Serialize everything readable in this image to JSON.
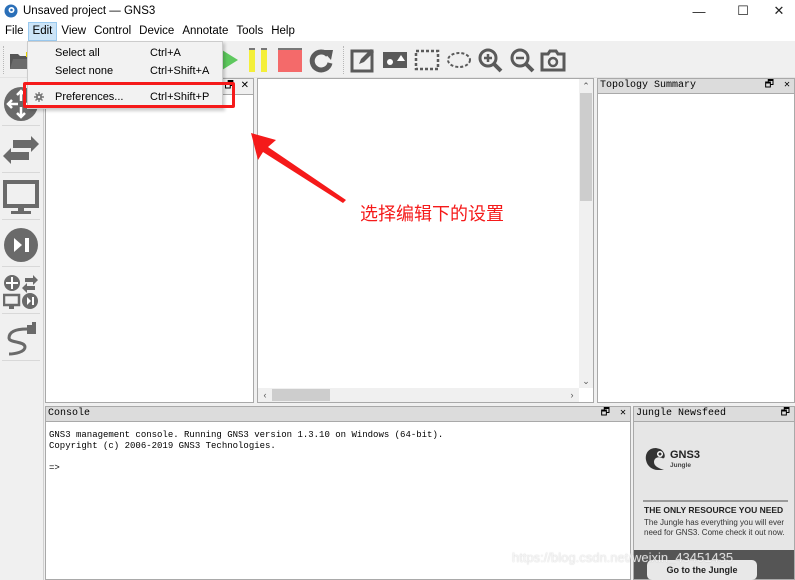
{
  "window": {
    "title": "Unsaved project — GNS3",
    "controls": {
      "minimize": "—",
      "maximize": "☐",
      "close": "✕"
    }
  },
  "menubar": {
    "items": [
      {
        "label": "File"
      },
      {
        "label": "Edit",
        "active": true
      },
      {
        "label": "View"
      },
      {
        "label": "Control"
      },
      {
        "label": "Device"
      },
      {
        "label": "Annotate"
      },
      {
        "label": "Tools"
      },
      {
        "label": "Help"
      }
    ]
  },
  "edit_menu": {
    "items": [
      {
        "label": "Select all",
        "shortcut": "Ctrl+A",
        "icon": ""
      },
      {
        "label": "Select none",
        "shortcut": "Ctrl+Shift+A",
        "icon": ""
      },
      {
        "label": "Preferences...",
        "shortcut": "Ctrl+Shift+P",
        "icon": "gear-icon",
        "highlighted": true
      }
    ]
  },
  "toolbar": {
    "icons": [
      "folder-open-icon",
      "start-icon",
      "suspend-icon",
      "stop-icon",
      "reload-icon",
      "add-note-icon",
      "insert-picture-icon",
      "draw-rectangle-icon",
      "draw-ellipse-icon",
      "zoom-in-icon",
      "zoom-out-icon",
      "screenshot-icon"
    ]
  },
  "devicebar": {
    "items": [
      "routers",
      "switches",
      "end-devices",
      "security-devices",
      "all-devices",
      "add-link"
    ]
  },
  "panels": {
    "nodes": {
      "controls": "🗗 ✕"
    },
    "topology_summary": {
      "title": "Topology Summary",
      "controls": "🗗 ✕"
    },
    "console": {
      "title": "Console",
      "controls": "🗗 ✕",
      "lines": [
        "GNS3 management console. Running GNS3 version 1.3.10 on Windows (64-bit).",
        "Copyright (c) 2006-2019 GNS3 Technologies.",
        "",
        "=>"
      ]
    },
    "newsfeed": {
      "title": "Jungle Newsfeed",
      "controls": "🗗",
      "logo_title": "GNS3",
      "logo_subtitle": "Jungle",
      "headline": "THE ONLY RESOURCE YOU NEED",
      "description": "The Jungle has everything you will ever need for GNS3. Come check it out now.",
      "button": "Go to the Jungle"
    }
  },
  "annotation": {
    "text": "选择编辑下的设置",
    "color": "#f51a1a"
  },
  "watermark": "https://blog.csdn.net/weixin_43451435"
}
